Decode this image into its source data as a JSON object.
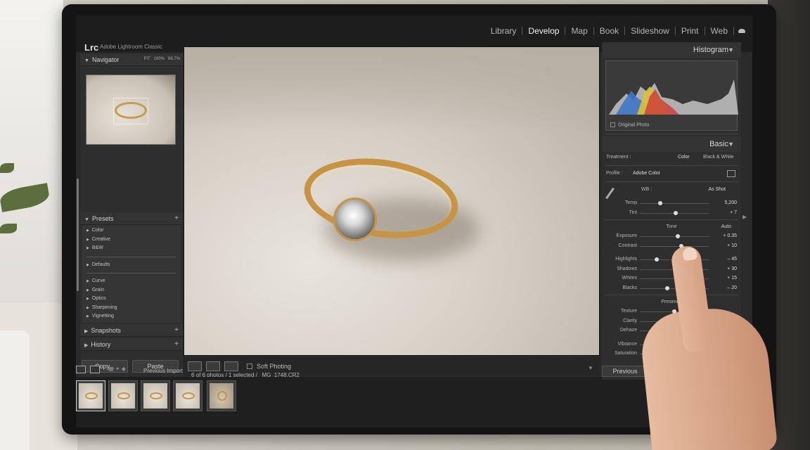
{
  "app": {
    "logo": "Lrc",
    "name": "Adobe Lightroom Classic",
    "modules": [
      "Library",
      "Develop",
      "Map",
      "Book",
      "Slideshow",
      "Print",
      "Web"
    ],
    "active_module": "Develop"
  },
  "navigator": {
    "title": "Navigator",
    "zoom_options": [
      "FIT",
      "100%",
      "66.7%"
    ]
  },
  "presets": {
    "title": "Presets",
    "group1": [
      "Color",
      "Creative",
      "B&W"
    ],
    "group2": [
      "Defaults"
    ],
    "group3": [
      "Curve",
      "Grain",
      "Optics",
      "Sharpening",
      "Vignetting"
    ]
  },
  "snapshots": {
    "title": "Snapshots"
  },
  "history": {
    "title": "History"
  },
  "buttons": {
    "copy": "Copy...",
    "paste": "Paste",
    "previous": "Previous"
  },
  "toolbar": {
    "soft_proofing": "Soft Photing"
  },
  "filmstrip": {
    "source": "Previous Import",
    "count": "6 of 6 photos / 1 selected / _MG_1748.CR2"
  },
  "histogram": {
    "title": "Histogram",
    "original_photo": "Original Photo"
  },
  "basic": {
    "title": "Basic",
    "treatment_label": "Treatment :",
    "treatment_color": "Color",
    "treatment_bw": "Black & White",
    "profile_label": "Profile :",
    "profile_value": "Adobe Color",
    "wb_label": "WB :",
    "wb_value": "As Shot",
    "tone_title": "Tone",
    "tone_auto": "Auto",
    "presence_title": "Presence",
    "wb_sliders": [
      {
        "name": "Temp",
        "value": "5,200",
        "pos": 0.3
      },
      {
        "name": "Tint",
        "value": "+ 7",
        "pos": 0.52
      }
    ],
    "tone_sliders": [
      {
        "name": "Exposure",
        "value": "+ 0.35",
        "pos": 0.55
      },
      {
        "name": "Contrast",
        "value": "+ 10",
        "pos": 0.6
      }
    ],
    "tone_sliders2": [
      {
        "name": "Highlights",
        "value": "– 45",
        "pos": 0.24
      },
      {
        "name": "Shadows",
        "value": "+ 30",
        "pos": 0.64
      },
      {
        "name": "Whites",
        "value": "+ 15",
        "pos": 0.6
      },
      {
        "name": "Blacks",
        "value": "– 20",
        "pos": 0.4
      }
    ],
    "presence_sliders": [
      {
        "name": "Texture",
        "value": "",
        "pos": 0.5
      },
      {
        "name": "Clarity",
        "value": "",
        "pos": 0.55
      },
      {
        "name": "Dehaze",
        "value": "",
        "pos": 0.5
      }
    ],
    "presence_sliders2": [
      {
        "name": "Vibrance",
        "value": ""
      },
      {
        "name": "Saturation",
        "value": ""
      }
    ]
  }
}
